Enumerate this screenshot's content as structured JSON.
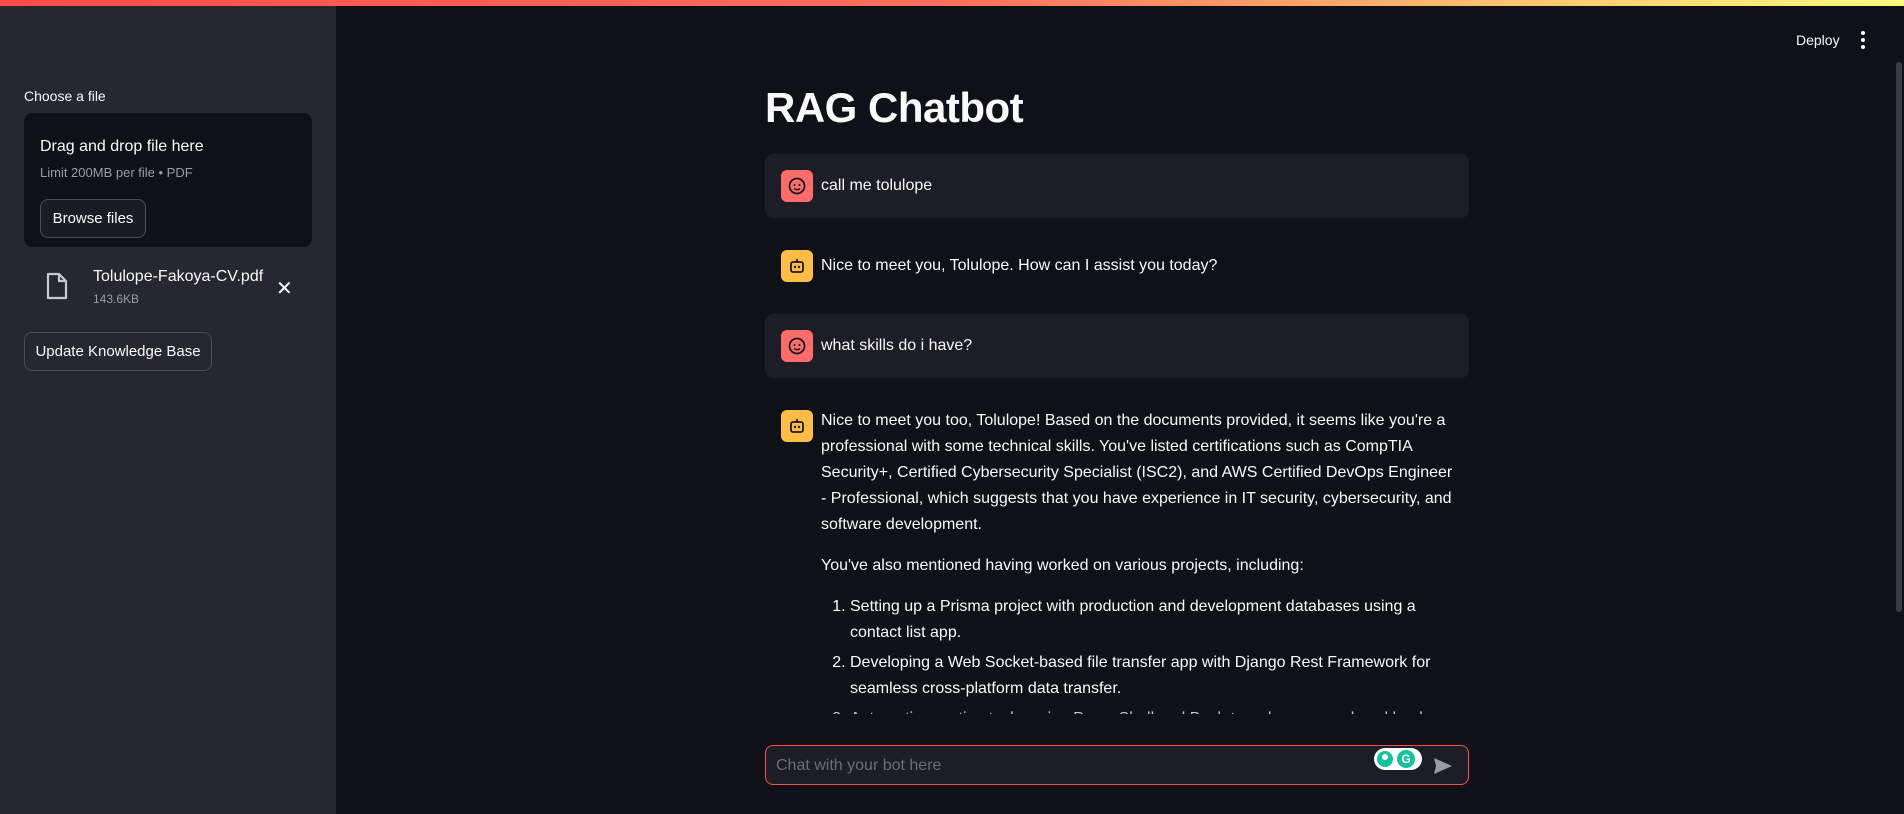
{
  "sidebar": {
    "uploader_label": "Choose a file",
    "dropzone_title": "Drag and drop file here",
    "dropzone_limit": "Limit 200MB per file • PDF",
    "browse_label": "Browse files",
    "file": {
      "name": "Tolulope-Fakoya-CV.pdf",
      "size": "143.6KB"
    },
    "update_label": "Update Knowledge Base"
  },
  "header": {
    "deploy_label": "Deploy"
  },
  "main": {
    "title": "RAG Chatbot",
    "messages": [
      {
        "role": "user",
        "text": "call me tolulope"
      },
      {
        "role": "assistant",
        "text": "Nice to meet you, Tolulope. How can I assist you today?"
      },
      {
        "role": "user",
        "text": "what skills do i have?"
      },
      {
        "role": "assistant",
        "para1": "Nice to meet you too, Tolulope! Based on the documents provided, it seems like you're a professional with some technical skills. You've listed certifications such as CompTIA Security+, Certified Cybersecurity Specialist (ISC2), and AWS Certified DevOps Engineer - Professional, which suggests that you have experience in IT security, cybersecurity, and software development.",
        "para2": "You've also mentioned having worked on various projects, including:",
        "list": [
          "Setting up a Prisma project with production and development databases using a contact list app.",
          "Developing a Web Socket-based file transfer app with Django Rest Framework for seamless cross-platform data transfer.",
          "Automating routine tasks using PowerShell and Bash to reduce manual workload."
        ]
      }
    ]
  },
  "chat_input": {
    "placeholder": "Chat with your bot here"
  },
  "colors": {
    "accent": "#ff4b4b",
    "user_avatar": "#ff6b6b",
    "bot_avatar": "#ffbd45"
  }
}
